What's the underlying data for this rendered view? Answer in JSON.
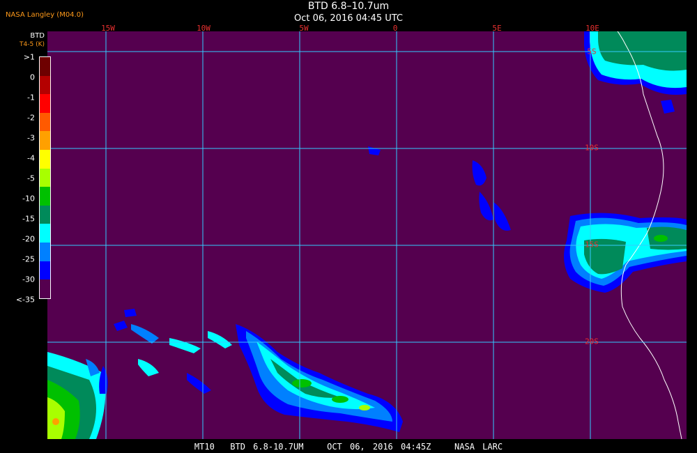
{
  "header": {
    "title": "BTD 6.8–10.7um",
    "subtitle": "Oct 06, 2016 04:45 UTC",
    "agency": "NASA Langley (M04.0)"
  },
  "legend": {
    "unit_line1": "BTD",
    "unit_line2": "T4-5 (K)",
    "ticks": [
      ">1",
      "0",
      "-1",
      "-2",
      "-3",
      "-4",
      "-5",
      "-10",
      "-15",
      "-20",
      "-25",
      "-30",
      "<-35"
    ],
    "colors": [
      "#6e0000",
      "#b40000",
      "#ff0000",
      "#ff5a00",
      "#ffa000",
      "#ffff00",
      "#a8ff00",
      "#00c000",
      "#008a5a",
      "#00ffff",
      "#0080ff",
      "#0000ff",
      "#55004f"
    ]
  },
  "grid": {
    "longitude_labels": [
      "15W",
      "10W",
      "5W",
      "0",
      "5E",
      "10E"
    ],
    "latitude_labels": [
      "5S",
      "10S",
      "15S",
      "20S"
    ],
    "line_color": "#33ccff",
    "label_color": "#e83030"
  },
  "footer": {
    "text": "MT10  BTD 6.8-10.7UM   OCT 06, 2016 04:45Z   NASA LARC"
  },
  "colors": {
    "background": "#55004f",
    "coastline": "#ffffff"
  }
}
